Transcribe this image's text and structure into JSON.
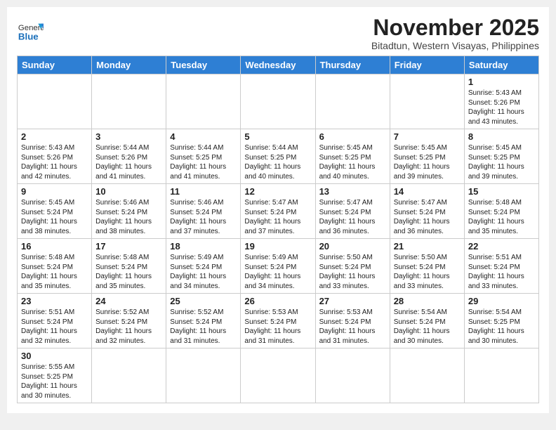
{
  "logo": {
    "line1": "General",
    "line2": "Blue"
  },
  "header": {
    "month": "November 2025",
    "location": "Bitadtun, Western Visayas, Philippines"
  },
  "weekdays": [
    "Sunday",
    "Monday",
    "Tuesday",
    "Wednesday",
    "Thursday",
    "Friday",
    "Saturday"
  ],
  "weeks": [
    [
      {
        "day": "",
        "info": ""
      },
      {
        "day": "",
        "info": ""
      },
      {
        "day": "",
        "info": ""
      },
      {
        "day": "",
        "info": ""
      },
      {
        "day": "",
        "info": ""
      },
      {
        "day": "",
        "info": ""
      },
      {
        "day": "1",
        "info": "Sunrise: 5:43 AM\nSunset: 5:26 PM\nDaylight: 11 hours\nand 43 minutes."
      }
    ],
    [
      {
        "day": "2",
        "info": "Sunrise: 5:43 AM\nSunset: 5:26 PM\nDaylight: 11 hours\nand 42 minutes."
      },
      {
        "day": "3",
        "info": "Sunrise: 5:44 AM\nSunset: 5:26 PM\nDaylight: 11 hours\nand 41 minutes."
      },
      {
        "day": "4",
        "info": "Sunrise: 5:44 AM\nSunset: 5:25 PM\nDaylight: 11 hours\nand 41 minutes."
      },
      {
        "day": "5",
        "info": "Sunrise: 5:44 AM\nSunset: 5:25 PM\nDaylight: 11 hours\nand 40 minutes."
      },
      {
        "day": "6",
        "info": "Sunrise: 5:45 AM\nSunset: 5:25 PM\nDaylight: 11 hours\nand 40 minutes."
      },
      {
        "day": "7",
        "info": "Sunrise: 5:45 AM\nSunset: 5:25 PM\nDaylight: 11 hours\nand 39 minutes."
      },
      {
        "day": "8",
        "info": "Sunrise: 5:45 AM\nSunset: 5:25 PM\nDaylight: 11 hours\nand 39 minutes."
      }
    ],
    [
      {
        "day": "9",
        "info": "Sunrise: 5:45 AM\nSunset: 5:24 PM\nDaylight: 11 hours\nand 38 minutes."
      },
      {
        "day": "10",
        "info": "Sunrise: 5:46 AM\nSunset: 5:24 PM\nDaylight: 11 hours\nand 38 minutes."
      },
      {
        "day": "11",
        "info": "Sunrise: 5:46 AM\nSunset: 5:24 PM\nDaylight: 11 hours\nand 37 minutes."
      },
      {
        "day": "12",
        "info": "Sunrise: 5:47 AM\nSunset: 5:24 PM\nDaylight: 11 hours\nand 37 minutes."
      },
      {
        "day": "13",
        "info": "Sunrise: 5:47 AM\nSunset: 5:24 PM\nDaylight: 11 hours\nand 36 minutes."
      },
      {
        "day": "14",
        "info": "Sunrise: 5:47 AM\nSunset: 5:24 PM\nDaylight: 11 hours\nand 36 minutes."
      },
      {
        "day": "15",
        "info": "Sunrise: 5:48 AM\nSunset: 5:24 PM\nDaylight: 11 hours\nand 35 minutes."
      }
    ],
    [
      {
        "day": "16",
        "info": "Sunrise: 5:48 AM\nSunset: 5:24 PM\nDaylight: 11 hours\nand 35 minutes."
      },
      {
        "day": "17",
        "info": "Sunrise: 5:48 AM\nSunset: 5:24 PM\nDaylight: 11 hours\nand 35 minutes."
      },
      {
        "day": "18",
        "info": "Sunrise: 5:49 AM\nSunset: 5:24 PM\nDaylight: 11 hours\nand 34 minutes."
      },
      {
        "day": "19",
        "info": "Sunrise: 5:49 AM\nSunset: 5:24 PM\nDaylight: 11 hours\nand 34 minutes."
      },
      {
        "day": "20",
        "info": "Sunrise: 5:50 AM\nSunset: 5:24 PM\nDaylight: 11 hours\nand 33 minutes."
      },
      {
        "day": "21",
        "info": "Sunrise: 5:50 AM\nSunset: 5:24 PM\nDaylight: 11 hours\nand 33 minutes."
      },
      {
        "day": "22",
        "info": "Sunrise: 5:51 AM\nSunset: 5:24 PM\nDaylight: 11 hours\nand 33 minutes."
      }
    ],
    [
      {
        "day": "23",
        "info": "Sunrise: 5:51 AM\nSunset: 5:24 PM\nDaylight: 11 hours\nand 32 minutes."
      },
      {
        "day": "24",
        "info": "Sunrise: 5:52 AM\nSunset: 5:24 PM\nDaylight: 11 hours\nand 32 minutes."
      },
      {
        "day": "25",
        "info": "Sunrise: 5:52 AM\nSunset: 5:24 PM\nDaylight: 11 hours\nand 31 minutes."
      },
      {
        "day": "26",
        "info": "Sunrise: 5:53 AM\nSunset: 5:24 PM\nDaylight: 11 hours\nand 31 minutes."
      },
      {
        "day": "27",
        "info": "Sunrise: 5:53 AM\nSunset: 5:24 PM\nDaylight: 11 hours\nand 31 minutes."
      },
      {
        "day": "28",
        "info": "Sunrise: 5:54 AM\nSunset: 5:24 PM\nDaylight: 11 hours\nand 30 minutes."
      },
      {
        "day": "29",
        "info": "Sunrise: 5:54 AM\nSunset: 5:25 PM\nDaylight: 11 hours\nand 30 minutes."
      }
    ],
    [
      {
        "day": "30",
        "info": "Sunrise: 5:55 AM\nSunset: 5:25 PM\nDaylight: 11 hours\nand 30 minutes."
      },
      {
        "day": "",
        "info": ""
      },
      {
        "day": "",
        "info": ""
      },
      {
        "day": "",
        "info": ""
      },
      {
        "day": "",
        "info": ""
      },
      {
        "day": "",
        "info": ""
      },
      {
        "day": "",
        "info": ""
      }
    ]
  ]
}
